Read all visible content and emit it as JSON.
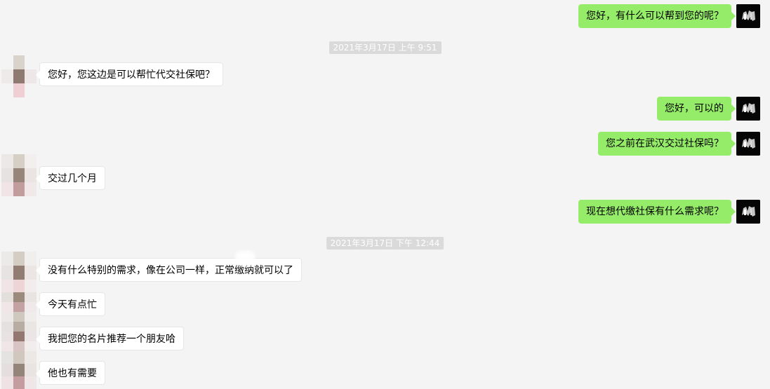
{
  "colors": {
    "background": "#f4f4f4",
    "outgoing_bubble": "#95ec69",
    "incoming_bubble": "#ffffff",
    "timestamp_bg": "#dadada"
  },
  "messages": [
    {
      "sender": "me",
      "text": "您好，有什么可以帮到您的呢？"
    },
    {
      "type": "timestamp",
      "text": "2021年3月17日 上午 9:51"
    },
    {
      "sender": "contact",
      "text": "您好，您这边是可以帮忙代交社保吧？"
    },
    {
      "sender": "me",
      "text": "您好，可以的"
    },
    {
      "sender": "me",
      "text": "您之前在武汉交过社保吗？"
    },
    {
      "sender": "contact",
      "text": "交过几个月"
    },
    {
      "sender": "me",
      "text": "现在想代缴社保有什么需求呢？"
    },
    {
      "type": "timestamp",
      "text": "2021年3月17日 下午 12:44"
    },
    {
      "sender": "contact",
      "text": "没有什么特别的需求，像在公司一样，正常缴纳就可以了"
    },
    {
      "sender": "contact",
      "text": "今天有点忙"
    },
    {
      "sender": "contact",
      "text": "我把您的名片推荐一个朋友哈"
    },
    {
      "sender": "contact",
      "text": "他也有需要"
    }
  ],
  "icons": {
    "my_avatar": "avatar-icon",
    "contact_avatar": "avatar-icon"
  }
}
